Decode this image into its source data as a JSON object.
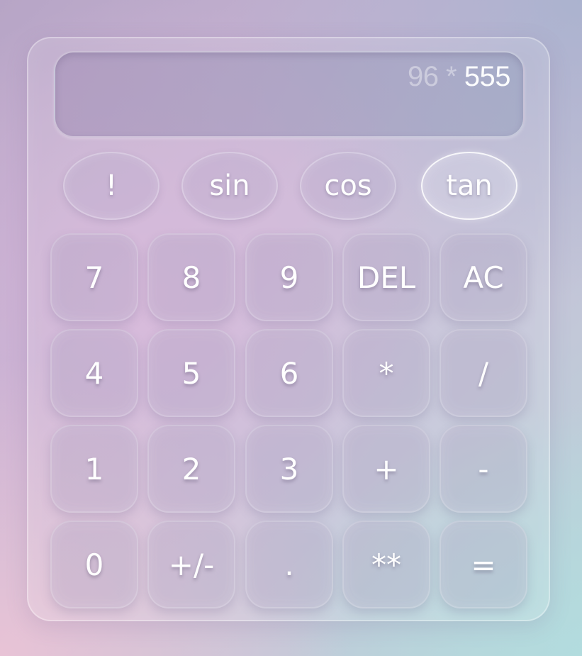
{
  "display": {
    "expression": "96 *",
    "current": "555"
  },
  "functions": [
    {
      "label": "!",
      "name": "factorial-button",
      "active": false
    },
    {
      "label": "sin",
      "name": "sin-button",
      "active": false
    },
    {
      "label": "cos",
      "name": "cos-button",
      "active": false
    },
    {
      "label": "tan",
      "name": "tan-button",
      "active": true
    }
  ],
  "keypad": [
    [
      {
        "label": "7",
        "name": "digit-7-button"
      },
      {
        "label": "8",
        "name": "digit-8-button"
      },
      {
        "label": "9",
        "name": "digit-9-button"
      },
      {
        "label": "DEL",
        "name": "delete-button"
      },
      {
        "label": "AC",
        "name": "all-clear-button"
      }
    ],
    [
      {
        "label": "4",
        "name": "digit-4-button"
      },
      {
        "label": "5",
        "name": "digit-5-button"
      },
      {
        "label": "6",
        "name": "digit-6-button"
      },
      {
        "label": "*",
        "name": "multiply-button"
      },
      {
        "label": "/",
        "name": "divide-button"
      }
    ],
    [
      {
        "label": "1",
        "name": "digit-1-button"
      },
      {
        "label": "2",
        "name": "digit-2-button"
      },
      {
        "label": "3",
        "name": "digit-3-button"
      },
      {
        "label": "+",
        "name": "add-button"
      },
      {
        "label": "-",
        "name": "subtract-button"
      }
    ],
    [
      {
        "label": "0",
        "name": "digit-0-button"
      },
      {
        "label": "+/-",
        "name": "negate-button"
      },
      {
        "label": ".",
        "name": "decimal-point-button"
      },
      {
        "label": "**",
        "name": "power-button"
      },
      {
        "label": "=",
        "name": "equals-button"
      }
    ]
  ]
}
